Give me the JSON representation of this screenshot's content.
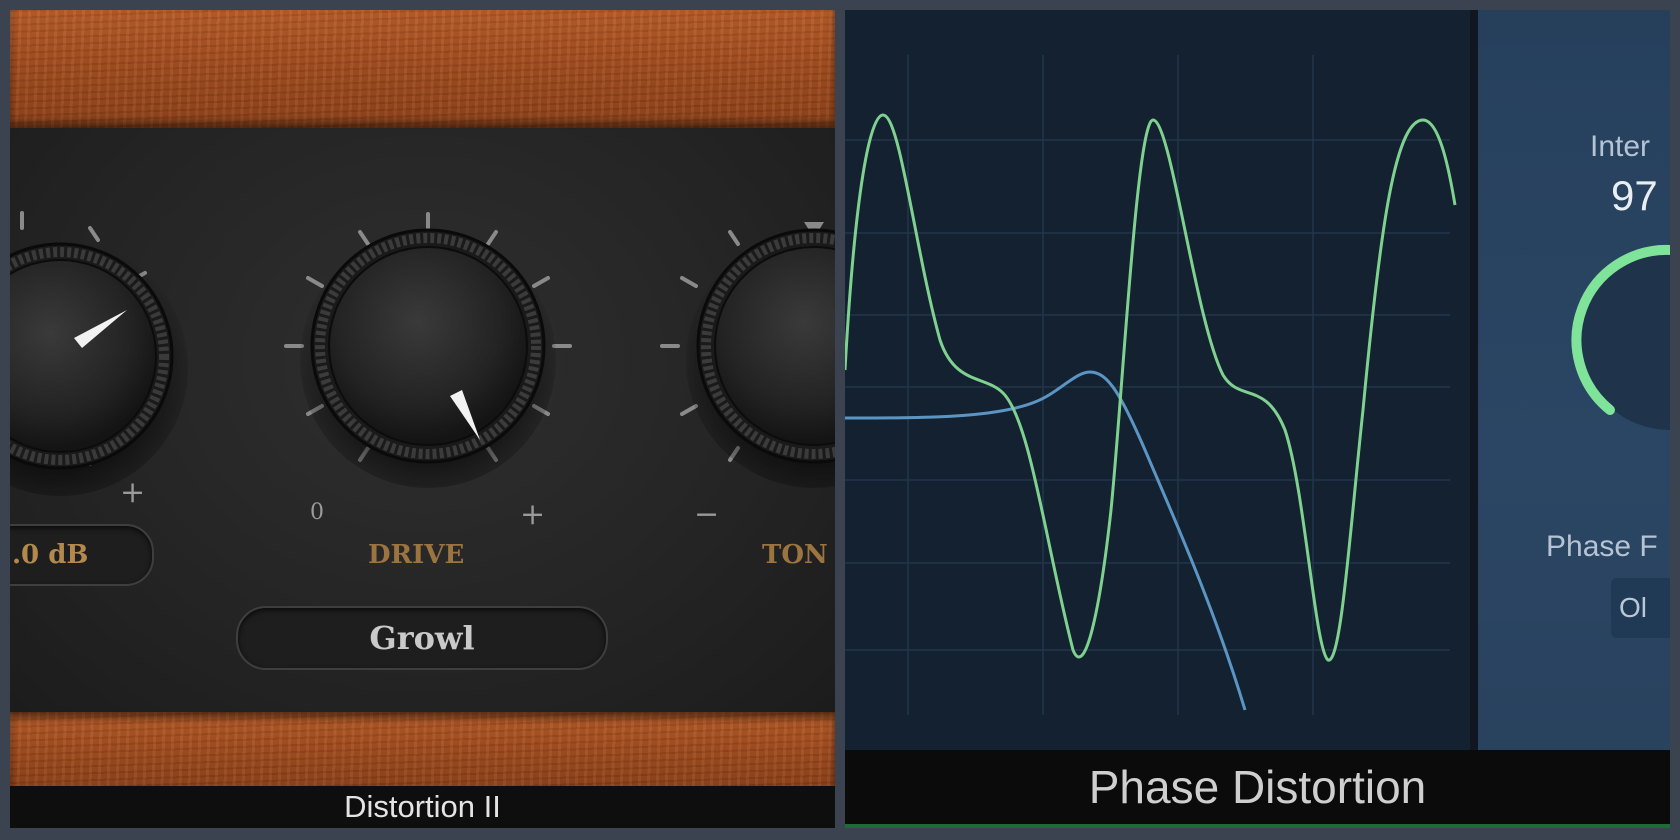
{
  "left_plugin": {
    "title": "Distortion II",
    "gain_value": ".0 dB",
    "drive_label": "DRIVE",
    "tone_label": "TON",
    "type_value": "Growl",
    "scale_zero": "0",
    "scale_plus": "+",
    "scale_minus": "−",
    "colors": {
      "wood": "#a14a1b",
      "leather": "#262626",
      "label_gold": "#9c7440"
    }
  },
  "right_plugin": {
    "title": "Phase Distortion",
    "intensity_label": "Inter",
    "intensity_value": "97",
    "phase_label": "Phase F",
    "phase_button": "Ol",
    "colors": {
      "green_wave": "#7fd18f",
      "blue_wave": "#5b95c4",
      "grid_bg": "#142130",
      "panel_bg": "#26405c"
    }
  }
}
